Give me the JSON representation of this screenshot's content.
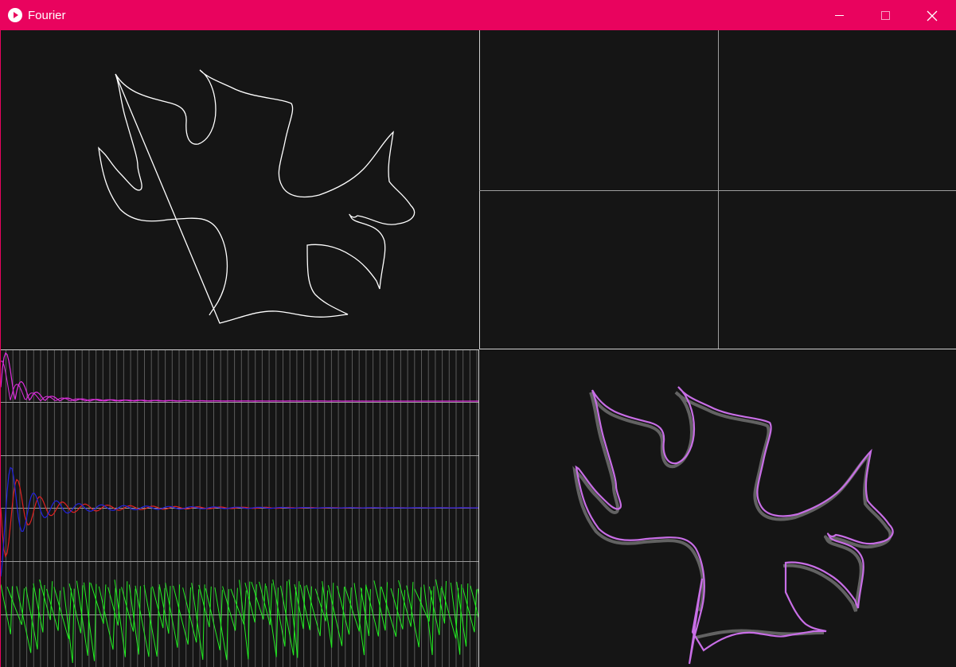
{
  "window": {
    "title": "Fourier",
    "icon": "play-circle-icon",
    "controls": [
      "minimize-icon",
      "maximize-icon",
      "close-icon"
    ],
    "titlebar_color": "#e9035e"
  },
  "panels": {
    "input_drawing": {
      "stroke_color": "#ffffff"
    },
    "epicycle_view": {
      "axis_color": "#bdbdbd"
    },
    "spectrum_plots": {
      "magnitude_color": "#e02ee0",
      "real_color": "#e02020",
      "imag_color": "#2222dd",
      "phase_color": "#22ee22"
    },
    "reconstruction": {
      "original_color": "#6a6a6a",
      "reconstructed_color": "#c86ee6"
    }
  }
}
